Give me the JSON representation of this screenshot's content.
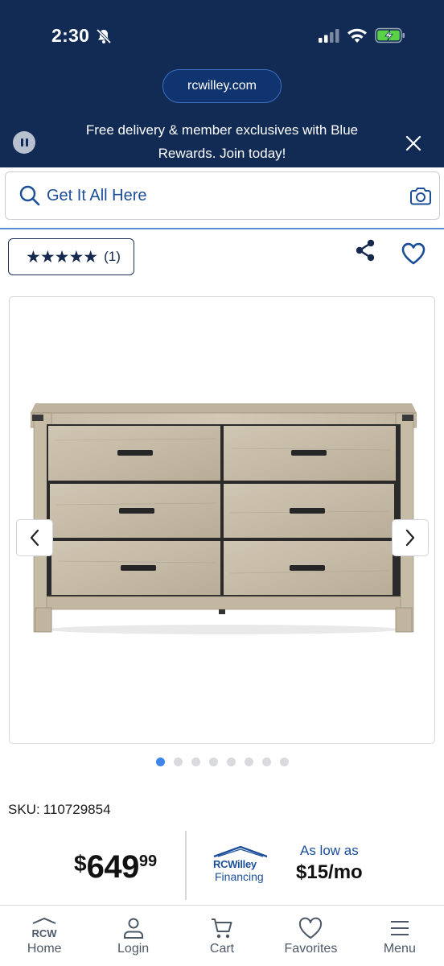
{
  "status_bar": {
    "time": "2:30"
  },
  "browser": {
    "url": "rcwilley.com"
  },
  "promo": {
    "text": "Free delivery & member exclusives with Blue Rewards. Join today!"
  },
  "search": {
    "placeholder": "Get It All Here"
  },
  "rating": {
    "stars": "★★★★★",
    "count": "(1)"
  },
  "gallery": {
    "image_count": 8,
    "active_index": 0
  },
  "product": {
    "sku_label": "SKU:",
    "sku": "110729854"
  },
  "price": {
    "currency": "$",
    "dollars": "649",
    "cents": "99"
  },
  "financing": {
    "brand": "RCWilley",
    "label": "Financing",
    "as_low_as": "As low as",
    "monthly": "$15/mo"
  },
  "tabbar": {
    "home_logo": "RCW",
    "items": [
      {
        "label": "Home",
        "icon": "home-logo-icon"
      },
      {
        "label": "Login",
        "icon": "user-icon"
      },
      {
        "label": "Cart",
        "icon": "cart-icon"
      },
      {
        "label": "Favorites",
        "icon": "heart-icon"
      },
      {
        "label": "Menu",
        "icon": "menu-icon"
      }
    ]
  },
  "colors": {
    "header_bg": "#112b55",
    "accent_blue": "#1b4e99",
    "active_dot": "#3d86e8"
  }
}
